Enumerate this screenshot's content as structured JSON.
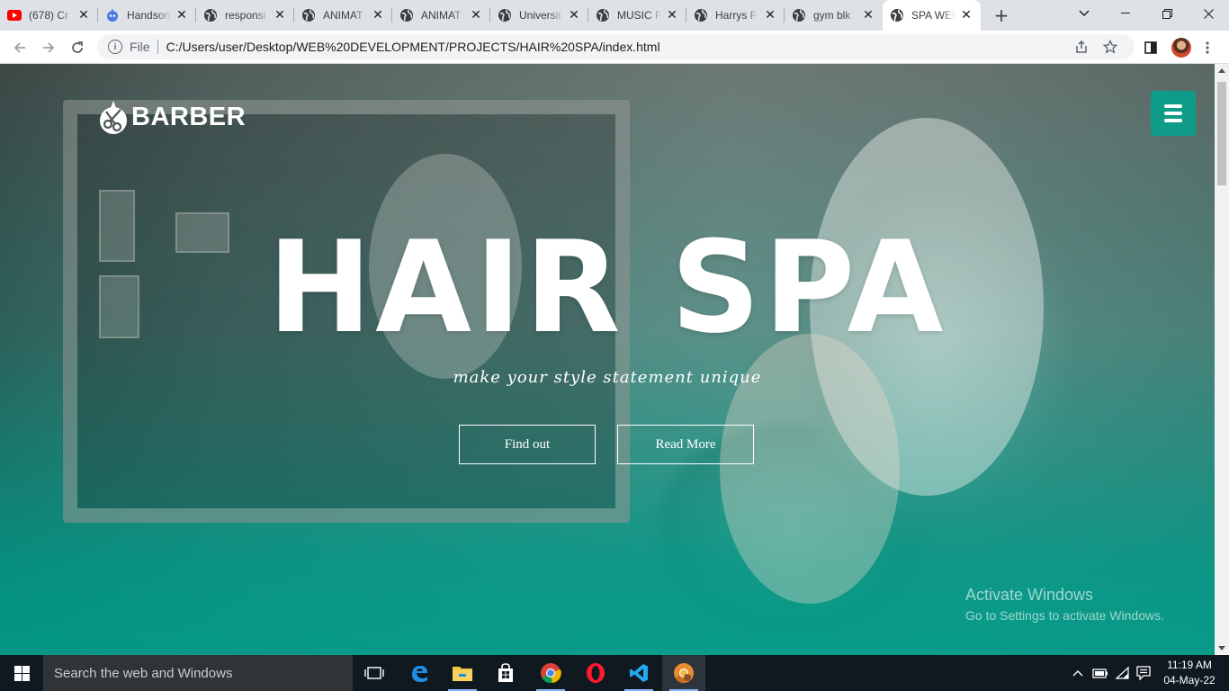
{
  "browser": {
    "tabs": [
      {
        "title": "(678) Cr",
        "icon": "youtube-icon"
      },
      {
        "title": "Handsom",
        "icon": "robot-icon"
      },
      {
        "title": "responsi",
        "icon": "globe-icon"
      },
      {
        "title": "ANIMAT",
        "icon": "globe-icon"
      },
      {
        "title": "ANIMAT",
        "icon": "globe-icon"
      },
      {
        "title": "Universit",
        "icon": "globe-icon"
      },
      {
        "title": "MUSIC P",
        "icon": "globe-icon"
      },
      {
        "title": "Harrys F",
        "icon": "globe-icon"
      },
      {
        "title": "gym blk",
        "icon": "globe-icon"
      },
      {
        "title": "SPA WEB",
        "icon": "globe-icon",
        "active": true
      }
    ],
    "new_tab": "+",
    "address": {
      "scheme_label": "File",
      "url": "C:/Users/user/Desktop/WEB%20DEVELOPMENT/PROJECTS/HAIR%20SPA/index.html"
    }
  },
  "page": {
    "logo_text": "BARBER",
    "hero_title": "HAIR SPA",
    "hero_subtitle": "make your style statement unique",
    "buttons": {
      "find_out": "Find out",
      "read_more": "Read More"
    },
    "accent_color": "#0e9b88"
  },
  "watermark": {
    "line1": "Activate Windows",
    "line2": "Go to Settings to activate Windows."
  },
  "taskbar": {
    "search_placeholder": "Search the web and Windows",
    "apps": [
      "task-view-icon",
      "edge-icon",
      "file-explorer-icon",
      "store-icon",
      "chrome-icon",
      "opera-icon",
      "vscode-icon",
      "chrome-canary-icon"
    ],
    "time": "11:19 AM",
    "date": "04-May-22"
  }
}
